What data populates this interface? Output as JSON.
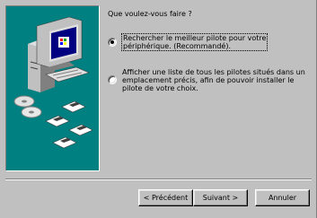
{
  "wizard": {
    "question": "Que voulez-vous faire ?",
    "options": [
      {
        "lines": [
          "Rechercher le meilleur pilote pour votre",
          "périphérique. (Recommandé)."
        ],
        "selected": true
      },
      {
        "lines": [
          "Afficher une liste de tous les pilotes situés dans un",
          "emplacement précis, afin de pouvoir installer le",
          "pilote de votre choix."
        ],
        "selected": false
      }
    ],
    "illustration": "computer-with-cds-and-floppies-icon"
  },
  "buttons": {
    "back_label": "< Précédent",
    "next_label": "Suivant >",
    "cancel_label": "Annuler"
  },
  "colors": {
    "dialog_face": "#c0c0c0",
    "illustration_background": "#008080"
  }
}
